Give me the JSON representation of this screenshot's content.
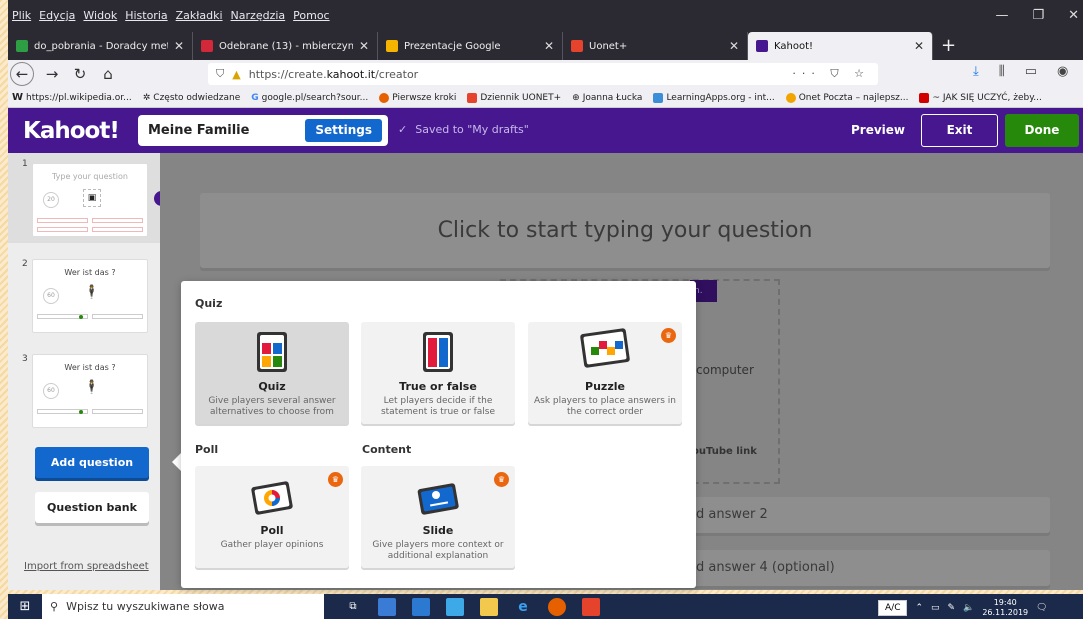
{
  "browser": {
    "menus": [
      "Plik",
      "Edycja",
      "Widok",
      "Historia",
      "Zakładki",
      "Narzędzia",
      "Pomoc"
    ],
    "tabs": [
      {
        "title": "do_pobrania - Doradcy metody",
        "color": "#2e9e44"
      },
      {
        "title": "Odebrane (13) - mbierczynska",
        "color": "#d3283a"
      },
      {
        "title": "Prezentacje Google",
        "color": "#f4b400"
      },
      {
        "title": "Uonet+",
        "color": "#e5432b"
      },
      {
        "title": "Kahoot!",
        "color": "#46178f"
      }
    ],
    "url_prefix": "https://create.",
    "url_domain": "kahoot.it",
    "url_path": "/creator",
    "url_right_icons": "··· ⛉ ☆",
    "bookmarks": [
      {
        "label": "https://pl.wikipedia.or...",
        "color": "#333"
      },
      {
        "label": "Często odwiedzane",
        "color": "#666"
      },
      {
        "label": "google.pl/search?sour...",
        "color": "#4285f4"
      },
      {
        "label": "Pierwsze kroki",
        "color": "#e66000"
      },
      {
        "label": "Dziennik UONET+",
        "color": "#e5432b"
      },
      {
        "label": "Joanna Łucka",
        "color": "#555"
      },
      {
        "label": "LearningApps.org - int...",
        "color": "#3c8fd6"
      },
      {
        "label": "Onet Poczta – najlepsz...",
        "color": "#f0a500"
      },
      {
        "label": "~ JAK SIĘ UCZYĆ, żeby...",
        "color": "#d30000"
      }
    ]
  },
  "kahoot": {
    "logo": "Kahoot!",
    "title": "Meine Familie",
    "settings": "Settings",
    "saved": "Saved to \"My drafts\"",
    "preview": "Preview",
    "exit": "Exit",
    "done": "Done"
  },
  "sidebar": {
    "questions": [
      {
        "num": "1",
        "title": "Type your question",
        "time": "20"
      },
      {
        "num": "2",
        "title": "Wer ist das ?",
        "time": "60"
      },
      {
        "num": "3",
        "title": "Wer ist das ?",
        "time": "60"
      }
    ],
    "warning_mark": "!",
    "add_question": "Add question",
    "question_bank": "Question bank",
    "import": "Import from spreadsheet"
  },
  "editor": {
    "question_placeholder": "Click to start typing your question",
    "media_text": "computer",
    "youtube": "ouTube link",
    "purple_hint": "n.",
    "answer2": "d answer 2",
    "answer4": "d answer 4 (optional)"
  },
  "popup": {
    "sections": {
      "quiz": "Quiz",
      "poll": "Poll",
      "content": "Content"
    },
    "cards": {
      "quiz": {
        "name": "Quiz",
        "desc": "Give players several answer alternatives to choose from"
      },
      "truefalse": {
        "name": "True or false",
        "desc": "Let players decide if the statement is true or false"
      },
      "puzzle": {
        "name": "Puzzle",
        "desc": "Ask players to place answers in the correct order"
      },
      "poll": {
        "name": "Poll",
        "desc": "Gather player opinions"
      },
      "slide": {
        "name": "Slide",
        "desc": "Give players more context or additional explanation"
      }
    }
  },
  "taskbar": {
    "search_placeholder": "Wpisz tu wyszukiwane słowa",
    "ac": "A/C",
    "time": "19:40",
    "date": "26.11.2019"
  },
  "colors": {
    "kahoot_purple": "#46178f",
    "kahoot_blue": "#1368ce",
    "kahoot_green": "#26890c",
    "kahoot_red": "#e21b3c",
    "kahoot_yellow": "#ffa602",
    "premium_orange": "#eb670f"
  }
}
